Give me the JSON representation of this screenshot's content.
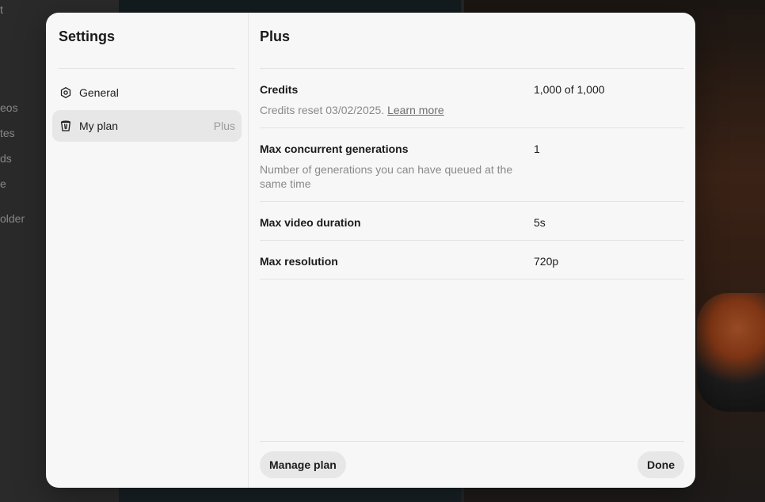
{
  "background": {
    "nav_items": [
      "t",
      "eos",
      "tes",
      "ds",
      "e",
      "older"
    ]
  },
  "settings": {
    "title": "Settings",
    "items": [
      {
        "label": "General",
        "icon": "gear-icon"
      },
      {
        "label": "My plan",
        "icon": "plan-icon",
        "badge": "Plus"
      }
    ]
  },
  "plan": {
    "title": "Plus",
    "credits": {
      "label": "Credits",
      "value": "1,000 of 1,000",
      "desc": "Credits reset 03/02/2025.",
      "link": "Learn more"
    },
    "concurrent": {
      "label": "Max concurrent generations",
      "value": "1",
      "desc": "Number of generations you can have queued at the same time"
    },
    "duration": {
      "label": "Max video duration",
      "value": "5s"
    },
    "resolution": {
      "label": "Max resolution",
      "value": "720p"
    },
    "manage_label": "Manage plan",
    "done_label": "Done"
  }
}
